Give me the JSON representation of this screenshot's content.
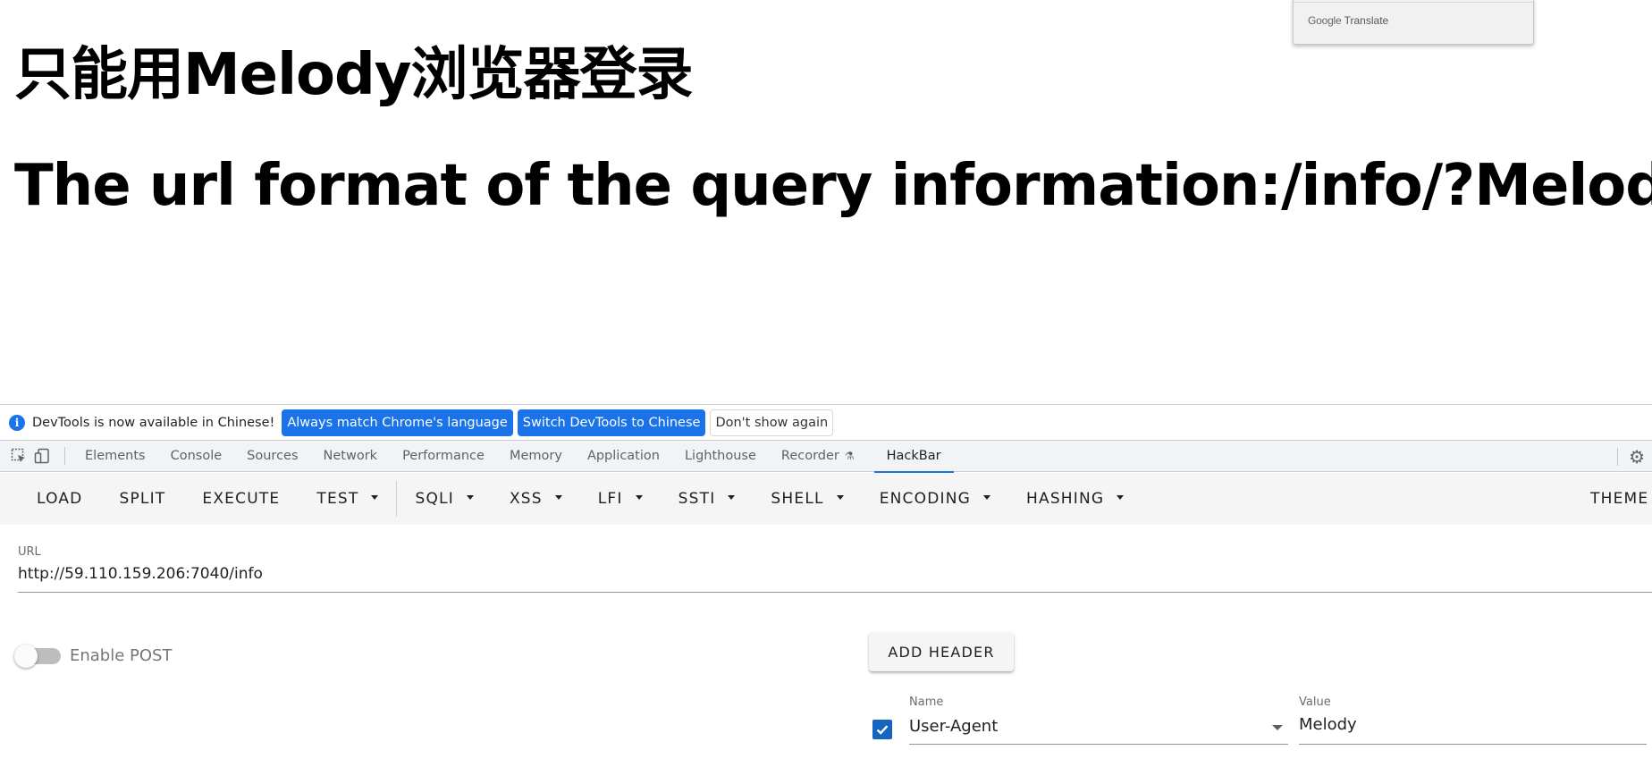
{
  "page": {
    "heading1": "只能用Melody浏览器登录",
    "heading2": "The url format of the query information:/info/?Melody="
  },
  "translate_popup": {
    "google": "Google",
    "translate": "Translate"
  },
  "devtools": {
    "infobar": {
      "message": "DevTools is now available in Chinese!",
      "btn_match": "Always match Chrome's language",
      "btn_switch": "Switch DevTools to Chinese",
      "btn_dismiss": "Don't show again"
    },
    "tabs": [
      {
        "label": "Elements"
      },
      {
        "label": "Console"
      },
      {
        "label": "Sources"
      },
      {
        "label": "Network"
      },
      {
        "label": "Performance"
      },
      {
        "label": "Memory"
      },
      {
        "label": "Application"
      },
      {
        "label": "Lighthouse"
      },
      {
        "label": "Recorder"
      },
      {
        "label": "HackBar"
      }
    ],
    "active_tab": "HackBar"
  },
  "hackbar": {
    "toolbar": {
      "load": "LOAD",
      "split": "SPLIT",
      "execute": "EXECUTE",
      "test": "TEST",
      "sqli": "SQLI",
      "xss": "XSS",
      "lfi": "LFI",
      "ssti": "SSTI",
      "shell": "SHELL",
      "encoding": "ENCODING",
      "hashing": "HASHING",
      "theme": "THEME"
    },
    "url_label": "URL",
    "url_value": "http://59.110.159.206:7040/info",
    "enable_post_label": "Enable POST",
    "enable_post": false,
    "add_header_label": "ADD HEADER",
    "header": {
      "enabled": true,
      "name_label": "Name",
      "name_value": "User-Agent",
      "value_label": "Value",
      "value_value": "Melody"
    }
  },
  "colors": {
    "accent": "#1a73e8",
    "checkbox": "#1565c0",
    "toolbar_bg": "#f5f5f5"
  }
}
